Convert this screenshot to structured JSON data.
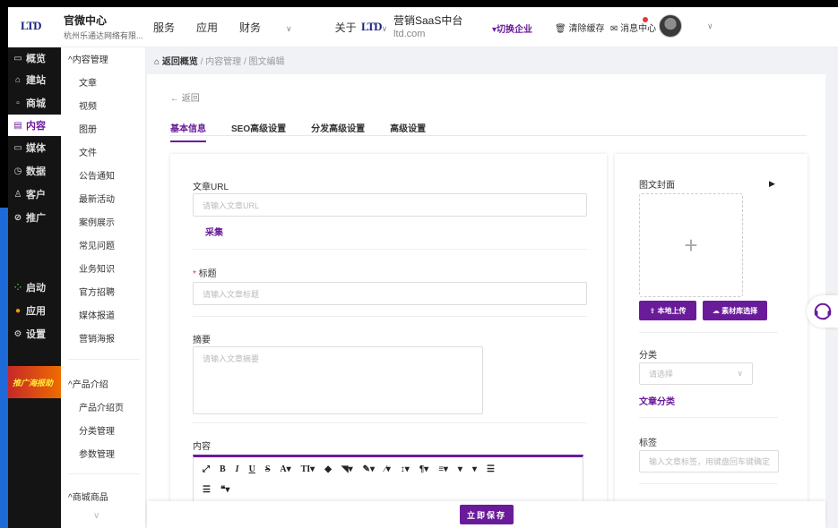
{
  "header": {
    "logo": "LTD",
    "org_title": "官微中心",
    "org_sub": "杭州乐通达网络有限...",
    "nav": [
      "服务",
      "应用",
      "财务",
      "关于"
    ],
    "saas_logo": "LTD",
    "saas_title": "营销SaaS中台",
    "saas_domain": "ltd.com",
    "switch": "▾切换企业",
    "clear_cache": "清除缓存",
    "messages": "消息中心"
  },
  "dark_sidebar": [
    {
      "label": "概览",
      "icon": "monitor-icon"
    },
    {
      "label": "建站",
      "icon": "home-icon"
    },
    {
      "label": "商城",
      "icon": "shop-icon"
    },
    {
      "label": "内容",
      "icon": "document-icon"
    },
    {
      "label": "媒体",
      "icon": "media-icon"
    },
    {
      "label": "数据",
      "icon": "clock-icon"
    },
    {
      "label": "客户",
      "icon": "user-icon"
    },
    {
      "label": "推广",
      "icon": "link-icon"
    },
    {
      "label": "启动",
      "icon": "launch-icon"
    },
    {
      "label": "应用",
      "icon": "apps-icon"
    },
    {
      "label": "设置",
      "icon": "settings-icon"
    }
  ],
  "promo": "推广海报助",
  "light_sidebar": {
    "groups": [
      {
        "title": "^内容管理",
        "items": [
          "文章",
          "视频",
          "图册",
          "文件",
          "公告通知",
          "最新活动",
          "案例展示",
          "常见问题",
          "业务知识",
          "官方招聘",
          "媒体报道",
          "营销海报"
        ]
      },
      {
        "title": "^产品介绍",
        "items": [
          "产品介绍页",
          "分类管理",
          "参数管理"
        ]
      },
      {
        "title": "^商城商品",
        "items": []
      }
    ]
  },
  "breadcrumb": {
    "home": "返回概览",
    "sep": "/",
    "b1": "内容管理",
    "b2": "图文编辑"
  },
  "back": "← 返回",
  "tabs": [
    "基本信息",
    "SEO高级设置",
    "分发高级设置",
    "高级设置"
  ],
  "form": {
    "url_label": "文章URL",
    "url_placeholder": "请输入文章URL",
    "collect": "采集",
    "title_label": "标题",
    "title_placeholder": "请输入文章标题",
    "summary_label": "摘要",
    "summary_placeholder": "请输入文章摘要",
    "content_label": "内容",
    "toolbar_row1": [
      "⤢",
      "B",
      "I",
      "U",
      "S",
      "A▾",
      "TI▾",
      "◆",
      "◥▾",
      "✎▾",
      "⁄▾",
      "↕▾",
      "¶▾",
      "≡▾",
      "▾",
      "▾",
      "☰"
    ],
    "toolbar_row2": [
      "☰",
      "❝▾"
    ]
  },
  "right": {
    "cover_label": "图文封面",
    "plus": "+",
    "upload_local": "本地上传",
    "library": "素材库选择",
    "category_label": "分类",
    "category_placeholder": "请选择",
    "category_link": "文章分类",
    "tag_label": "标签",
    "tag_placeholder": "输入文章标签，用键盘回车键确定"
  },
  "save": "立即保存"
}
